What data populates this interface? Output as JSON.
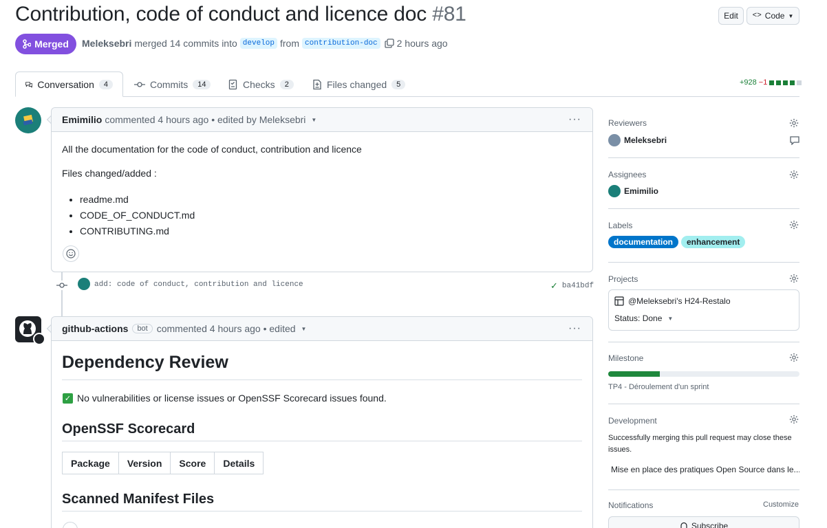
{
  "header": {
    "title": "Contribution, code of conduct and licence doc",
    "number": "#81",
    "edit_label": "Edit",
    "code_label": "Code",
    "status": "Merged",
    "author": "Meleksebri",
    "merged_text": "merged 14 commits into",
    "base_branch": "develop",
    "from_text": "from",
    "head_branch": "contribution-doc",
    "time": "2 hours ago"
  },
  "tabs": [
    {
      "label": "Conversation",
      "count": "4"
    },
    {
      "label": "Commits",
      "count": "14"
    },
    {
      "label": "Checks",
      "count": "2"
    },
    {
      "label": "Files changed",
      "count": "5"
    }
  ],
  "diffstat": {
    "additions": "+928",
    "deletions": "−1"
  },
  "comment1": {
    "author": "Emimilio",
    "meta": "commented 4 hours ago • edited by Meleksebri",
    "line1": "All the documentation for the code of conduct, contribution and licence",
    "line2": "Files changed/added :",
    "files": [
      "readme.md",
      "CODE_OF_CONDUCT.md",
      "CONTRIBUTING.md"
    ]
  },
  "commit": {
    "message": "add: code of conduct, contribution and licence",
    "sha": "ba41bdf"
  },
  "comment2": {
    "author": "github-actions",
    "bot_label": "bot",
    "meta": "commented 4 hours ago • edited",
    "heading1": "Dependency Review",
    "check_text": "No vulnerabilities or license issues or OpenSSF Scorecard issues found.",
    "heading2": "OpenSSF Scorecard",
    "table_headers": [
      "Package",
      "Version",
      "Score",
      "Details"
    ],
    "heading3": "Scanned Manifest Files"
  },
  "sidebar": {
    "reviewers_label": "Reviewers",
    "reviewer": "Meleksebri",
    "assignees_label": "Assignees",
    "assignee": "Emimilio",
    "labels_label": "Labels",
    "labels": [
      "documentation",
      "enhancement"
    ],
    "projects_label": "Projects",
    "project_name": "@Meleksebri's H24-Restalo",
    "project_status": "Status: Done",
    "milestone_label": "Milestone",
    "milestone_progress": 0.27,
    "milestone_name": "TP4 - Déroulement d'un sprint",
    "development_label": "Development",
    "development_text": "Successfully merging this pull request may close these issues.",
    "development_issue": "Mise en place des pratiques Open Source dans le...",
    "notifications_label": "Notifications",
    "customize_label": "Customize",
    "subscribe_label": "Subscribe"
  },
  "colors": {
    "merged": "#8250df",
    "accent": "#0969da",
    "green": "#1a7f37",
    "documentation_label": "#0075ca",
    "enhancement_label": "#a2eeef"
  }
}
